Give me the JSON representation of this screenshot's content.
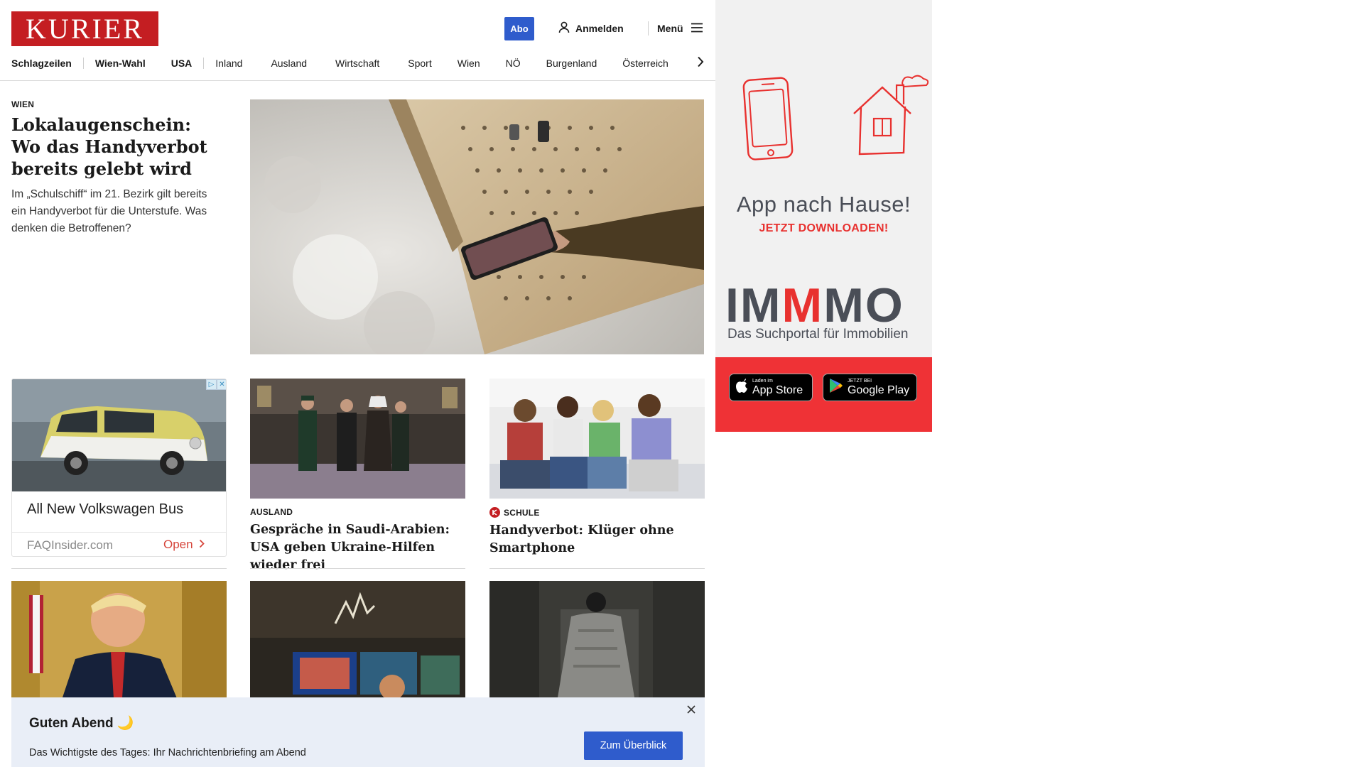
{
  "header": {
    "logo": "KURIER",
    "abo_label": "Abo",
    "login_label": "Anmelden",
    "menu_label": "Menü"
  },
  "nav": {
    "items": [
      {
        "label": "Schlagzeilen"
      },
      {
        "label": "Wien-Wahl"
      },
      {
        "label": "USA"
      },
      {
        "label": "Inland"
      },
      {
        "label": "Ausland"
      },
      {
        "label": "Wirtschaft"
      },
      {
        "label": "Sport"
      },
      {
        "label": "Wien"
      },
      {
        "label": "NÖ"
      },
      {
        "label": "Burgenland"
      },
      {
        "label": "Österreich"
      }
    ]
  },
  "lead": {
    "kicker": "Wien",
    "title": "Lokalaugenschein: Wo das Handyverbot bereits gelebt wird",
    "teaser": "Im „Schulschiff“ im 21. Bezirk gilt bereits ein Handyverbot für die Unterstufe. Was denken die Betroffenen?"
  },
  "ad_card": {
    "title": "All New Volkswagen Bus",
    "domain": "FAQInsider.com",
    "cta": "Open"
  },
  "cards": [
    {
      "kicker": "Ausland",
      "title": "Gespräche in Saudi-Arabien: USA geben Ukraine-Hilfen wieder frei"
    },
    {
      "kicker": "Schule",
      "title": "Handyverbot: Klüger ohne Smartphone"
    }
  ],
  "side_ad": {
    "app_title": "App nach Hause!",
    "app_subtitle": "JETZT DOWNLOADEN!",
    "brand_pre": "IM",
    "brand_mid": "M",
    "brand_post": "MO",
    "brand_subtitle": "Das Suchportal für Immobilien",
    "appstore_small": "Laden im",
    "appstore_big": "App Store",
    "googleplay_small": "JETZT BEI",
    "googleplay_big": "Google Play"
  },
  "notification": {
    "title": "Guten Abend 🌙",
    "text": "Das Wichtigste des Tages: Ihr Nachrichtenbriefing am Abend",
    "button": "Zum Überblick"
  },
  "colors": {
    "brand_red": "#c41e22",
    "button_blue": "#2f5ccc",
    "ad_red": "#ef3236"
  }
}
